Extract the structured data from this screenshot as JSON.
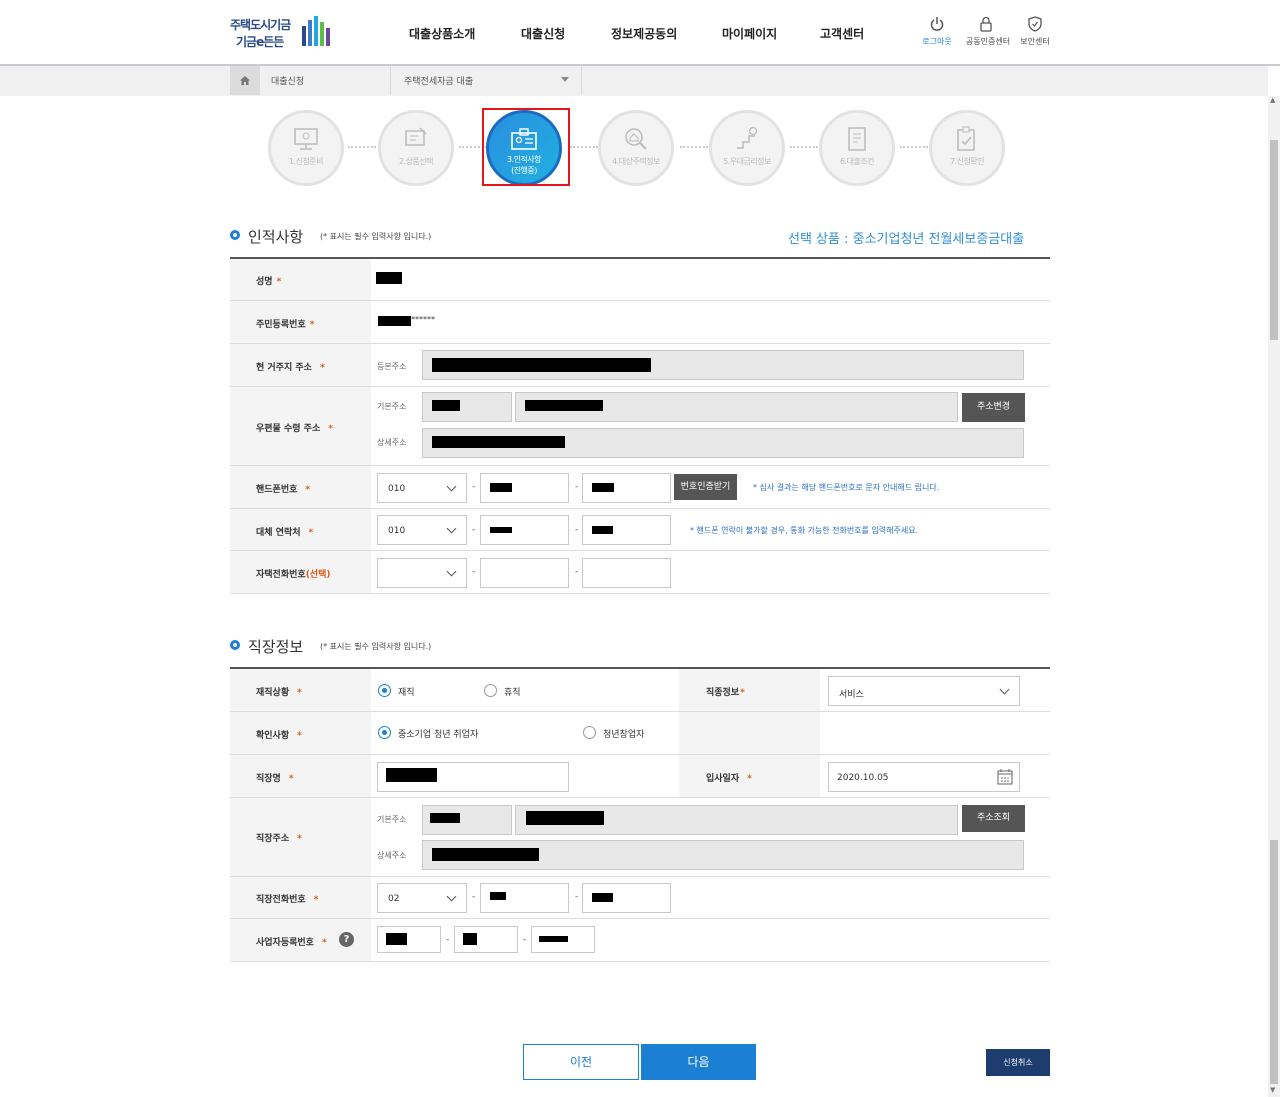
{
  "header": {
    "logo_line1": "주택도시기금",
    "logo_line2": "기금e든든",
    "nav": [
      "대출상품소개",
      "대출신청",
      "정보제공동의",
      "마이페이지",
      "고객센터"
    ],
    "util": [
      {
        "label": "로그아웃",
        "icon": "power-icon"
      },
      {
        "label": "공동인증센터",
        "icon": "lock-icon"
      },
      {
        "label": "보안센터",
        "icon": "shield-icon"
      }
    ]
  },
  "breadcrumb": {
    "first": "대출신청",
    "second": "주택전세자금 대출"
  },
  "steps": [
    {
      "label": "1.신청준비",
      "icon": "monitor-icon"
    },
    {
      "label": "2.상품선택",
      "icon": "product-select-icon"
    },
    {
      "label": "3.인적사항",
      "label2": "(진행중)",
      "icon": "id-card-icon"
    },
    {
      "label": "4.대상주택정보",
      "icon": "house-search-icon"
    },
    {
      "label": "5.우대금리정보",
      "icon": "rate-up-icon"
    },
    {
      "label": "6.대출조건",
      "icon": "document-icon"
    },
    {
      "label": "7.신청확인",
      "icon": "checklist-icon"
    }
  ],
  "personal": {
    "title": "인적사항",
    "note": "(* 표시는 필수 입력사항 입니다.)",
    "product": "선택 상품 : 중소기업청년 전월세보증금대출",
    "name_label": "성명",
    "rrn_label": "주민등록번호",
    "rrn_mask": "******",
    "addr_label": "현 거주지 주소",
    "addr_sub": "등본주소",
    "mail_label": "우편물 수령 주소",
    "mail_sub_basic": "기본주소",
    "mail_sub_detail": "상세주소",
    "mail_btn": "주소변경",
    "phone_label": "핸드폰번호",
    "phone_prefix": "010",
    "phone_btn": "번호인증받기",
    "phone_hint": "* 심사 결과는 해당 핸드폰번호로 문자 안내해드 립니다.",
    "alt_label": "대체 연락처",
    "alt_prefix": "010",
    "alt_hint": "* 핸드폰 연락이 불가할 경우, 통화 가능한 전화번호를 입력해주세요.",
    "home_label": "자택전화번호",
    "home_optional": "(선택)"
  },
  "work": {
    "title": "직장정보",
    "note": "(* 표시는 필수 입력사항 입니다.)",
    "status_label": "재직상황",
    "status_options": [
      "재직",
      "휴직"
    ],
    "job_label": "직종정보",
    "job_value": "서비스",
    "confirm_label": "확인사항",
    "confirm_options": [
      "중소기업 청년 취업자",
      "청년창업자"
    ],
    "company_label": "직장명",
    "join_label": "입사일자",
    "join_value": "2020.10.05",
    "waddr_label": "직장주소",
    "waddr_sub_basic": "기본주소",
    "waddr_sub_detail": "상세주소",
    "waddr_btn": "주소조회",
    "wphone_label": "직장전화번호",
    "wphone_prefix": "02",
    "biz_label": "사업자등록번호",
    "help": "?"
  },
  "buttons": {
    "prev": "이전",
    "next": "다음",
    "cancel": "신청취소"
  },
  "colors": {
    "accent": "#1b7fd4",
    "highlight": "#e8141c",
    "required": "#e05a1a",
    "hint": "#2a6fc8",
    "cancel_bg": "#1c3d6e"
  }
}
